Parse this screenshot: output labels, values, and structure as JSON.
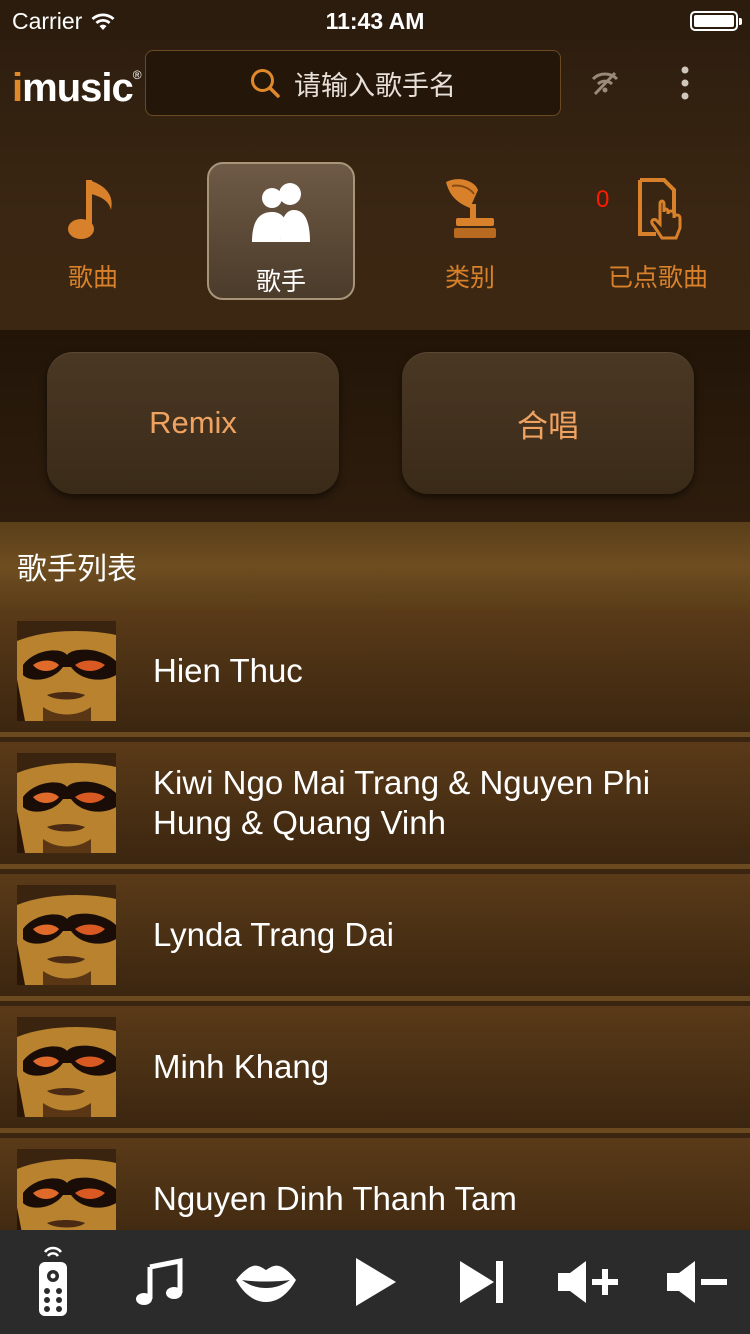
{
  "status_bar": {
    "carrier": "Carrier",
    "time": "11:43 AM"
  },
  "header": {
    "logo_i": "i",
    "logo_rest": "music",
    "logo_mark": "®",
    "search_placeholder": "请输入歌手名"
  },
  "categories": [
    {
      "label": "歌曲",
      "icon": "music-note-icon",
      "active": false
    },
    {
      "label": "歌手",
      "icon": "singer-icon",
      "active": true
    },
    {
      "label": "类别",
      "icon": "gramophone-icon",
      "active": false
    },
    {
      "label": "已点歌曲",
      "icon": "ordered-songs-icon",
      "active": false,
      "badge": "0"
    }
  ],
  "sub_buttons": [
    {
      "label": "Remix"
    },
    {
      "label": "合唱"
    }
  ],
  "section_title": "歌手列表",
  "singers": [
    {
      "name": "Hien Thuc"
    },
    {
      "name": "Kiwi Ngo Mai Trang & Nguyen Phi Hung & Quang Vinh"
    },
    {
      "name": "Lynda Trang Dai"
    },
    {
      "name": "Minh Khang"
    },
    {
      "name": "Nguyen Dinh Thanh Tam"
    }
  ],
  "toolbar": {
    "icons": [
      "remote-icon",
      "music-note-icon",
      "lips-icon",
      "play-icon",
      "next-icon",
      "volume-up-icon",
      "volume-down-icon"
    ]
  },
  "colors": {
    "accent": "#e0892a",
    "badge": "#ff1a00",
    "subbutton_text": "#f0a260"
  }
}
